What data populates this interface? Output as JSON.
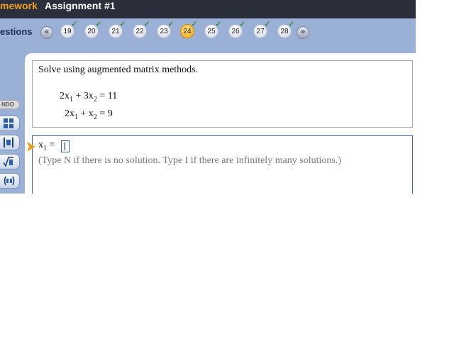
{
  "header": {
    "homework_label": "mework",
    "assignment_title": "Assignment #1"
  },
  "nav": {
    "questions_label": "estions",
    "prev_icon": "double-chevron-left-icon",
    "next_icon": "double-chevron-right-icon",
    "items": [
      {
        "label": "19",
        "status": "correct"
      },
      {
        "label": "20",
        "status": "correct"
      },
      {
        "label": "21",
        "status": "correct"
      },
      {
        "label": "22",
        "status": "correct"
      },
      {
        "label": "23",
        "status": "correct"
      },
      {
        "label": "24",
        "status": "partial",
        "current": true
      },
      {
        "label": "25",
        "status": "partial"
      },
      {
        "label": "26",
        "status": "correct"
      },
      {
        "label": "27",
        "status": "correct"
      },
      {
        "label": "28",
        "status": "partial"
      }
    ]
  },
  "toolbar": {
    "label": "NDO",
    "tools": [
      "matrix-icon",
      "absolute-value-icon",
      "square-root-icon",
      "interval-icon"
    ]
  },
  "question": {
    "instruction": "Solve using augmented matrix methods.",
    "eq1": {
      "c1": "2x",
      "s1": "1",
      "op": " + 3x",
      "s2": "2",
      "rhs": " = 11"
    },
    "eq2": {
      "c1": "2x",
      "s1": "1",
      "op": " + x",
      "s2": "2",
      "rhs": " = 9"
    }
  },
  "answer": {
    "var": "x",
    "sub": "1",
    "eq": " = ",
    "value": "",
    "hint": "(Type N if there is no solution. Type I if there are infinitely many solutions.)"
  },
  "colors": {
    "topbar": "#2b2f3b",
    "accent": "#f0a020",
    "navbar": "#9bb0d6",
    "current_question": "#f6b430",
    "correct_check": "#2f8f2f",
    "answer_border": "#3a6ab0"
  }
}
